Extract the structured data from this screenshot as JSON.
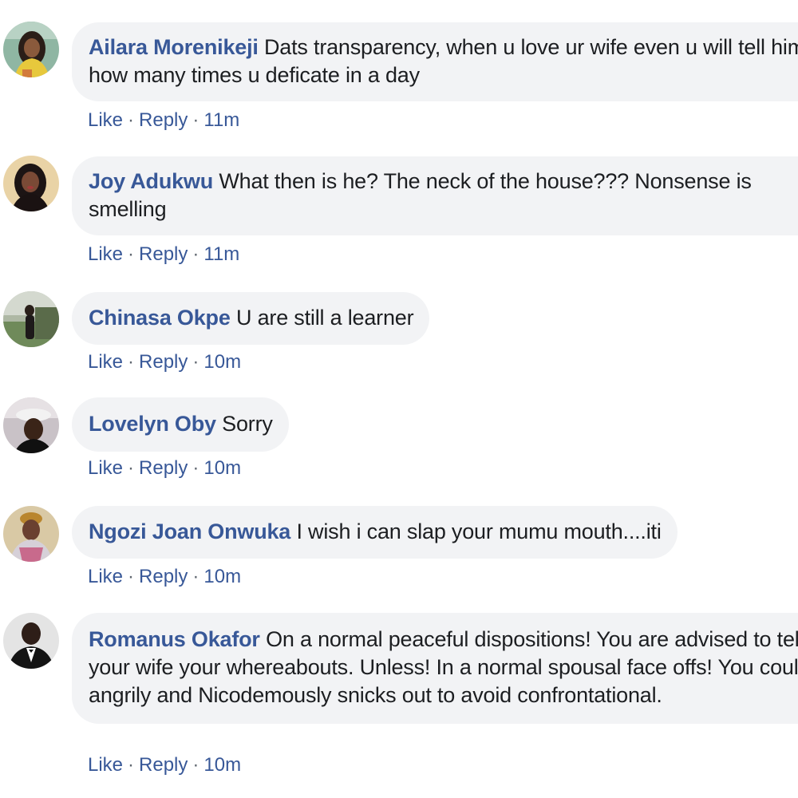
{
  "comments": [
    {
      "author": "Ailara Morenikeji",
      "text": "Dats transparency, when u love ur wife even u will tell him how many times u deficate in a day",
      "like": "Like",
      "reply": "Reply",
      "sep": "·",
      "time": "11m",
      "avatar_icon": "profile-photo-woman-yellow",
      "avatar_color": "#8fb6a3"
    },
    {
      "author": "Joy Adukwu",
      "text": "What then is he? The neck of the house??? Nonsense is smelling",
      "like": "Like",
      "reply": "Reply",
      "sep": "·",
      "time": "11m",
      "avatar_icon": "profile-photo-woman-dark",
      "avatar_color": "#e9d3a6"
    },
    {
      "author": "Chinasa Okpe",
      "text": "U are still a learner",
      "like": "Like",
      "reply": "Reply",
      "sep": "·",
      "time": "10m",
      "avatar_icon": "profile-photo-outdoor",
      "avatar_color": "#8a9a78"
    },
    {
      "author": "Lovelyn Oby",
      "text": "Sorry",
      "like": "Like",
      "reply": "Reply",
      "sep": "·",
      "time": "10m",
      "avatar_icon": "profile-photo-woman-hat",
      "avatar_color": "#c9c2c7"
    },
    {
      "author": "Ngozi Joan Onwuka",
      "text": "I wish i can slap your mumu mouth....iti",
      "like": "Like",
      "reply": "Reply",
      "sep": "·",
      "time": "10m",
      "avatar_icon": "profile-photo-woman-headwrap",
      "avatar_color": "#d9c9a5"
    },
    {
      "author": "Romanus Okafor",
      "text": "On a normal peaceful dispositions! You are advised to tell your wife your whereabouts. Unless! In a normal spousal face offs! You could angrily and Nicodemously snicks out to avoid confrontational.",
      "like": "Like",
      "reply": "Reply",
      "sep": "·",
      "time": "10m",
      "avatar_icon": "profile-photo-man-suit",
      "avatar_color": "#e4e4e4"
    }
  ]
}
